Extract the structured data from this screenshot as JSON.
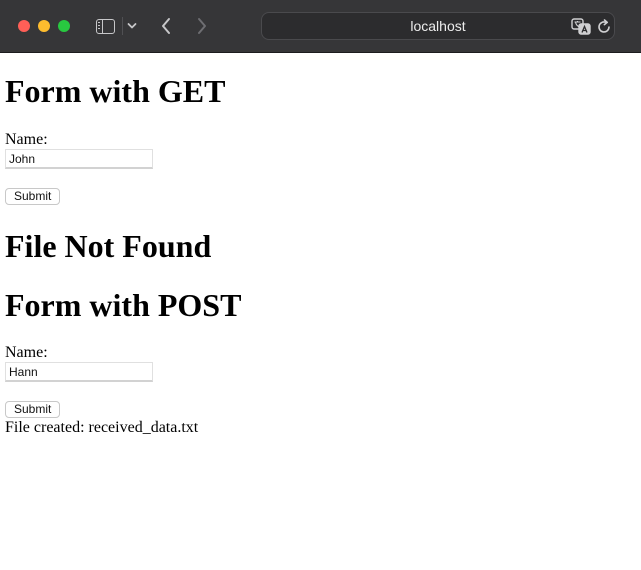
{
  "browser": {
    "address": "localhost",
    "icons": {
      "sidebar": "sidebar-toggle-icon",
      "dropdown": "chevron-down-icon",
      "back": "chevron-left-icon",
      "forward": "chevron-right-icon",
      "translate": "translate-icon",
      "reload": "reload-icon"
    },
    "colors": {
      "close": "#ff5f57",
      "minimize": "#febc2e",
      "zoom": "#28c840",
      "toolbar": "#363638"
    }
  },
  "get_form": {
    "heading": "Form with GET",
    "name_label": "Name:",
    "name_value": "John",
    "submit_label": "Submit"
  },
  "get_result": {
    "heading": "File Not Found"
  },
  "post_form": {
    "heading": "Form with POST",
    "name_label": "Name:",
    "name_value": "Hann",
    "submit_label": "Submit"
  },
  "post_result": {
    "message": "File created: received_data.txt"
  }
}
